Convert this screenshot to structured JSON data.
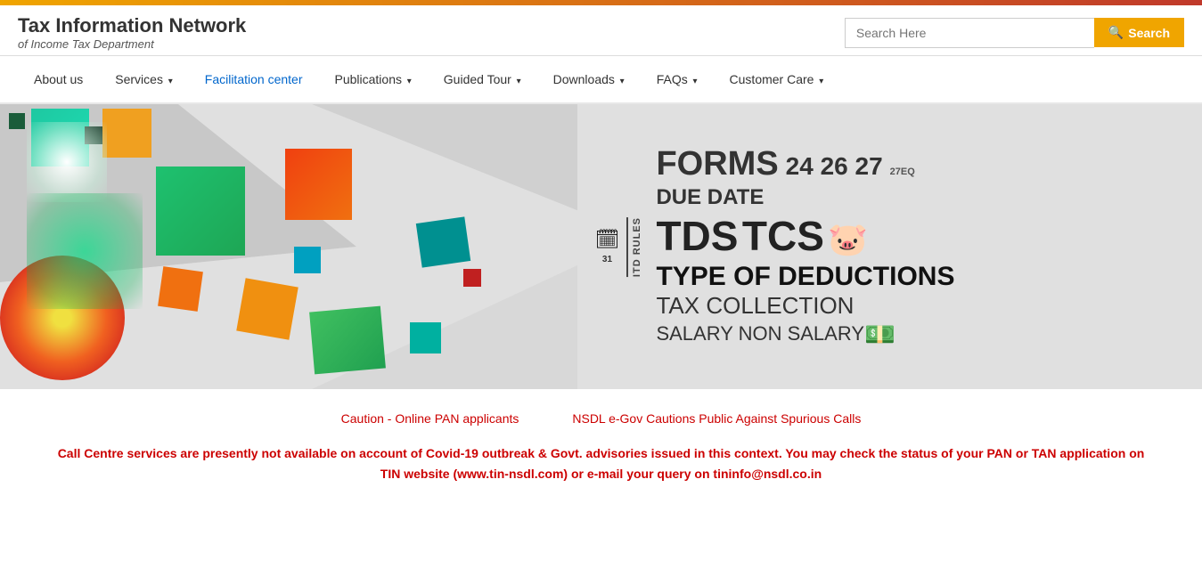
{
  "top_bar": {},
  "header": {
    "logo_title_line1": "Tax Information Network",
    "logo_title_line2": "of Income Tax Department",
    "search_placeholder": "Search Here",
    "search_button_label": "Search"
  },
  "nav": {
    "items": [
      {
        "label": "About us",
        "has_dropdown": false,
        "active": false
      },
      {
        "label": "Services",
        "has_dropdown": true,
        "active": false
      },
      {
        "label": "Facilitation center",
        "has_dropdown": false,
        "active": true
      },
      {
        "label": "Publications",
        "has_dropdown": true,
        "active": false
      },
      {
        "label": "Guided Tour",
        "has_dropdown": true,
        "active": false
      },
      {
        "label": "Downloads",
        "has_dropdown": true,
        "active": false
      },
      {
        "label": "FAQs",
        "has_dropdown": true,
        "active": false
      },
      {
        "label": "Customer Care",
        "has_dropdown": true,
        "active": false
      }
    ]
  },
  "banner": {
    "forms_word": "FORMS",
    "forms_numbers": "24  26  27",
    "forms_eq": "27EQ",
    "itd_rules": "ITD RULES",
    "due_date": "DUE DATE",
    "tds": "TDS",
    "tcs": "TCS",
    "type_deductions": "TYPE OF DEDUCTIONS",
    "tax_collection": "TAX COLLECTION",
    "salary_non_salary": "SALARY  NON SALARY"
  },
  "notices": {
    "link1": "Caution - Online PAN applicants",
    "link2": "NSDL e-Gov Cautions Public Against Spurious Calls"
  },
  "alert": {
    "text": "Call Centre services are presently not available on account of Covid-19 outbreak & Govt. advisories issued in this context. You may check the status of your PAN or TAN application on TIN website (www.tin-nsdl.com) or e-mail your query on tininfo@nsdl.co.in"
  },
  "colors": {
    "accent_orange": "#f0a500",
    "accent_red": "#c0392b",
    "link_blue": "#0066cc",
    "link_red": "#cc0000",
    "nav_active_blue": "#0066cc"
  }
}
